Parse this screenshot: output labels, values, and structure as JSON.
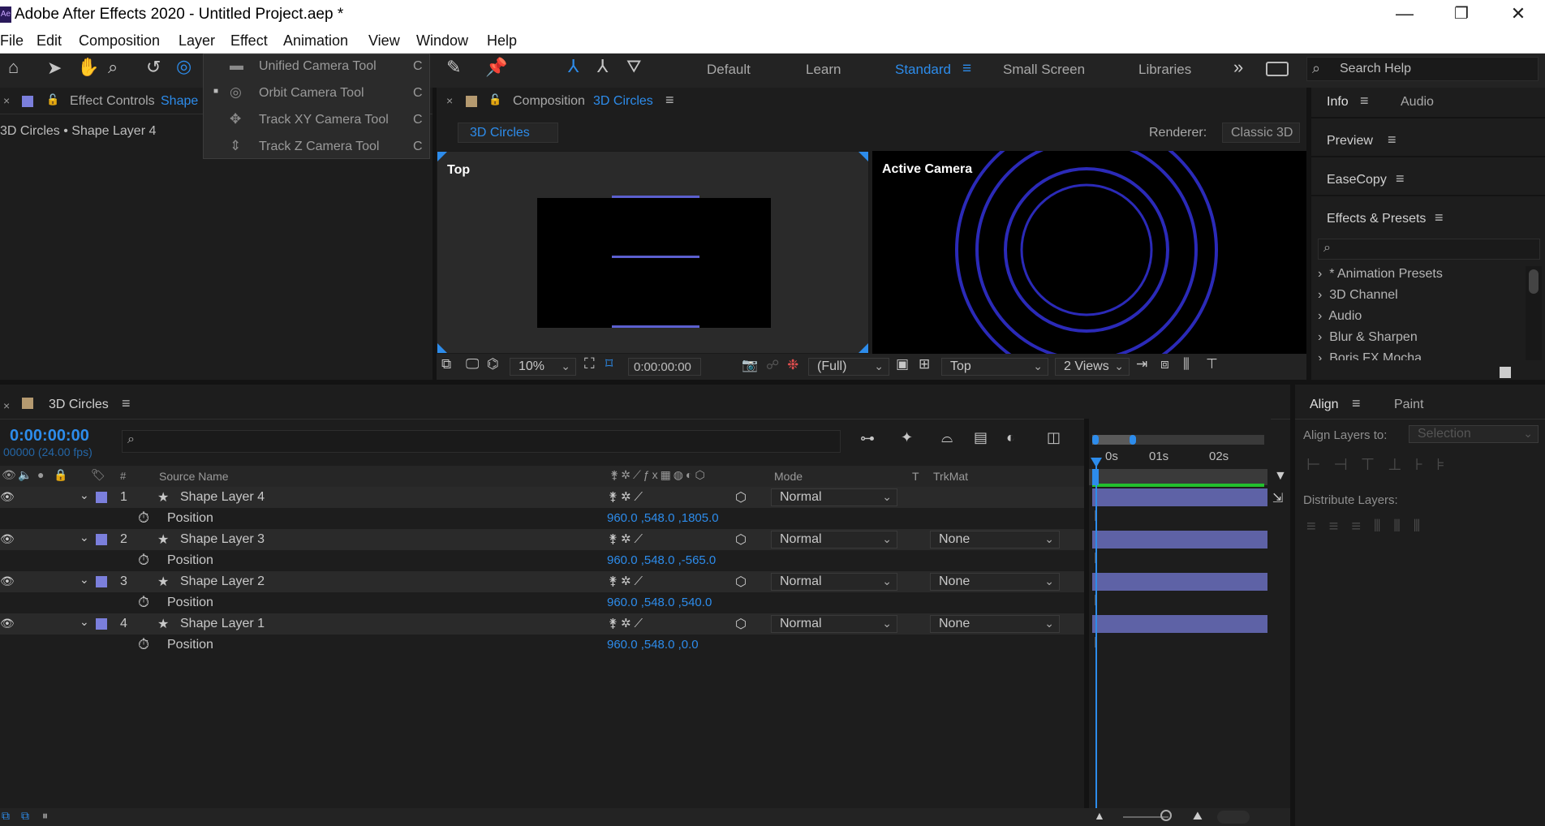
{
  "window": {
    "title": "Adobe After Effects 2020 - Untitled Project.aep *",
    "minimize": "—",
    "restore": "❐",
    "close": "✕"
  },
  "menu": [
    "File",
    "Edit",
    "Composition",
    "Layer",
    "Effect",
    "Animation",
    "View",
    "Window",
    "Help"
  ],
  "workspaces": [
    "Default",
    "Learn",
    "Standard",
    "Small Screen",
    "Libraries"
  ],
  "workspace_menu_icon": "≡",
  "more_icon": "»",
  "search_help": "Search Help",
  "camera_menu": [
    {
      "label": "Unified Camera Tool",
      "key": "C",
      "selected": false
    },
    {
      "label": "Orbit Camera Tool",
      "key": "C",
      "selected": true
    },
    {
      "label": "Track XY Camera Tool",
      "key": "C",
      "selected": false
    },
    {
      "label": "Track Z Camera Tool",
      "key": "C",
      "selected": false
    }
  ],
  "effect_controls": {
    "tab_label": "Effect Controls",
    "tab_target": "Shape",
    "breadcrumb": "3D Circles • Shape Layer 4"
  },
  "composition": {
    "tab_label": "Composition",
    "tab_name": "3D Circles",
    "comp_button": "3D Circles",
    "renderer_label": "Renderer:",
    "renderer_value": "Classic 3D",
    "view_left_label": "Top",
    "view_right_label": "Active Camera"
  },
  "viewer_bar": {
    "zoom": "10%",
    "timecode": "0:00:00:00",
    "resolution": "(Full)",
    "view": "Top",
    "layout": "2 Views"
  },
  "right_panels": {
    "info": "Info",
    "audio": "Audio",
    "preview": "Preview",
    "easecopy": "EaseCopy",
    "effects_presets": "Effects & Presets",
    "effects_list": [
      "* Animation Presets",
      "3D Channel",
      "Audio",
      "Blur & Sharpen",
      "Boris FX Mocha"
    ]
  },
  "align_panel": {
    "tab_align": "Align",
    "tab_paint": "Paint",
    "align_layers_to": "Align Layers to:",
    "align_target": "Selection",
    "distribute_layers": "Distribute Layers:"
  },
  "timeline": {
    "tab_label": "3D Circles",
    "timecode": "0:00:00:00",
    "frames": "00000 (24.00 fps)",
    "ruler": [
      "0s",
      "01s",
      "02s"
    ],
    "col_num": "#",
    "col_source": "Source Name",
    "col_mode": "Mode",
    "col_t": "T",
    "col_trkmat": "TrkMat",
    "layers": [
      {
        "num": "1",
        "name": "Shape Layer 4",
        "mode": "Normal",
        "trkmat": "",
        "prop": "Position",
        "value": "960.0 ,548.0 ,1805.0"
      },
      {
        "num": "2",
        "name": "Shape Layer 3",
        "mode": "Normal",
        "trkmat": "None",
        "prop": "Position",
        "value": "960.0 ,548.0 ,-565.0"
      },
      {
        "num": "3",
        "name": "Shape Layer 2",
        "mode": "Normal",
        "trkmat": "None",
        "prop": "Position",
        "value": "960.0 ,548.0 ,540.0"
      },
      {
        "num": "4",
        "name": "Shape Layer 1",
        "mode": "Normal",
        "trkmat": "None",
        "prop": "Position",
        "value": "960.0 ,548.0 ,0.0"
      }
    ]
  },
  "colors": {
    "accent": "#2d8ceb",
    "label_swatch": "#7b7fdc",
    "layer_bar": "#5e62a6",
    "circle_stroke": "#2b2ab8",
    "work_area": "#22c02e"
  }
}
